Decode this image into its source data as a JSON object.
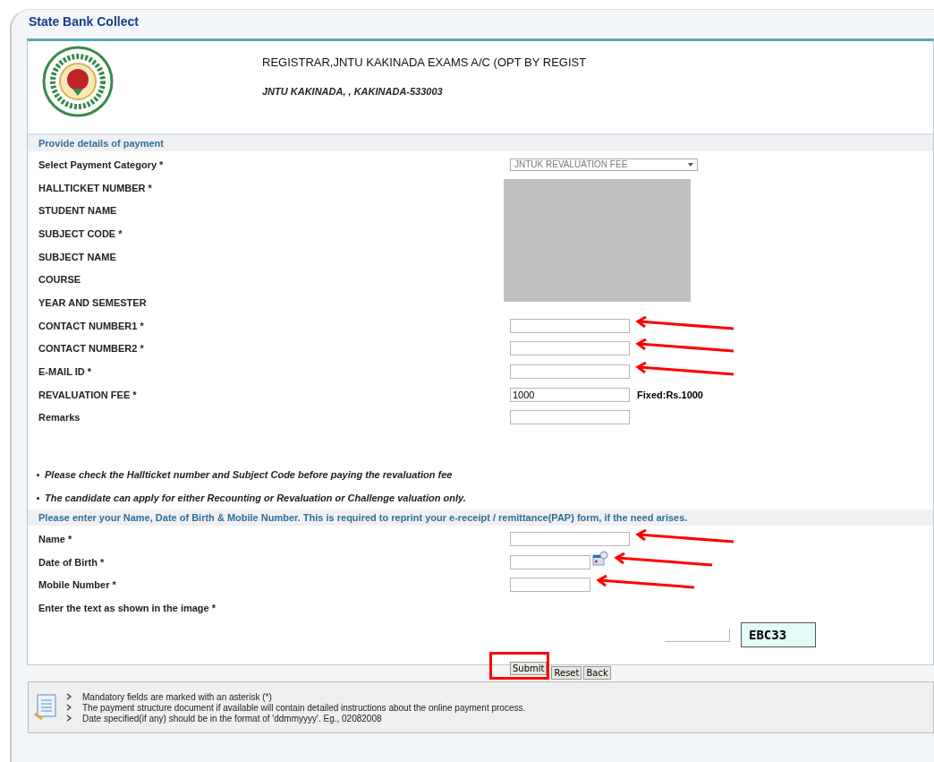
{
  "app_title": "State Bank Collect",
  "payee": {
    "name": "REGISTRAR,JNTU KAKINADA EXAMS A/C (OPT BY REGIST",
    "address": "JNTU KAKINADA, , KAKINADA-533003"
  },
  "payment_section": {
    "heading": "Provide details of payment",
    "fields": [
      {
        "kind": "select",
        "label": "Select Payment Category *",
        "value": "JNTUK REVALUATION FEE",
        "marked": false
      },
      {
        "kind": "hidden",
        "label": "HALLTICKET NUMBER *",
        "marked": false
      },
      {
        "kind": "hidden",
        "label": "STUDENT NAME",
        "marked": false
      },
      {
        "kind": "hidden",
        "label": "SUBJECT CODE *",
        "marked": false
      },
      {
        "kind": "hidden",
        "label": "SUBJECT NAME",
        "marked": false
      },
      {
        "kind": "hidden",
        "label": "COURSE",
        "marked": false
      },
      {
        "kind": "hidden",
        "label": "YEAR AND SEMESTER",
        "marked": false
      },
      {
        "kind": "input",
        "label": "CONTACT NUMBER1 *",
        "marked": true
      },
      {
        "kind": "input",
        "label": "CONTACT NUMBER2 *",
        "marked": true
      },
      {
        "kind": "input",
        "label": "E-MAIL ID *",
        "marked": true
      },
      {
        "kind": "input",
        "label": "REVALUATION FEE *",
        "value": "1000",
        "note": "Fixed:Rs.1000",
        "marked": false
      },
      {
        "kind": "input",
        "label": "Remarks",
        "marked": false
      }
    ],
    "notes": [
      "Please check the Hallticket number and Subject Code before paying the revaluation fee",
      "The candidate can apply for either Recounting or Revaluation or Challenge valuation only."
    ]
  },
  "personal_section": {
    "heading": "Please enter your Name, Date of Birth & Mobile Number. This is required to reprint your e-receipt / remittance(PAP) form, if the need arises.",
    "fields": [
      {
        "kind": "input",
        "label": "Name *",
        "marked": true
      },
      {
        "kind": "date",
        "label": "Date of Birth *",
        "marked": true
      },
      {
        "kind": "short",
        "label": "Mobile Number *",
        "marked": true
      },
      {
        "kind": "captcha",
        "label": "Enter the text as shown in the image *",
        "captcha": "EBC33",
        "marked": false
      }
    ]
  },
  "buttons": [
    {
      "label": "Submit",
      "highlighted": true
    },
    {
      "label": "Reset",
      "highlighted": false
    },
    {
      "label": "Back",
      "highlighted": false
    }
  ],
  "info_notes": [
    "Mandatory fields are marked with an asterisk (*)",
    "The payment structure document if available will contain detailed instructions about the online payment process.",
    "Date specified(if any) should be in the format of 'ddmmyyyy'. Eg., 02082008"
  ]
}
